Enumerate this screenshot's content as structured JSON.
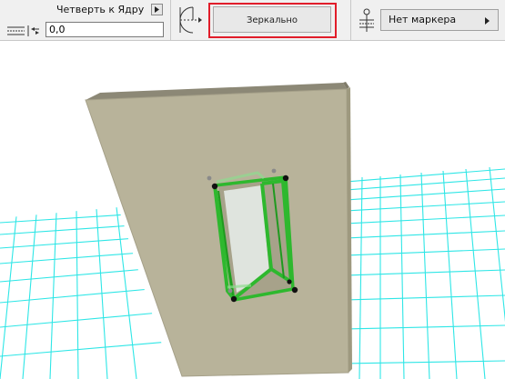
{
  "toolbar": {
    "reveal_label": "Четверть к Ядру",
    "offset_value": "0,0",
    "mirror_button": "Зеркально",
    "marker_value": "Нет маркера"
  },
  "icons": {
    "reveal_arrow": "triangle-right-icon",
    "anchor": "wall-anchor-offset-icon",
    "mirror": "door-mirror-swing-icon",
    "marker": "dimension-marker-icon",
    "marker_caret": "triangle-right-icon"
  },
  "colors": {
    "toolbar_bg": "#f0f0f0",
    "highlight": "#e11d2a",
    "wall": "#b8b39a",
    "grid": "#2ee6e6",
    "selection": "#2eb82e"
  }
}
